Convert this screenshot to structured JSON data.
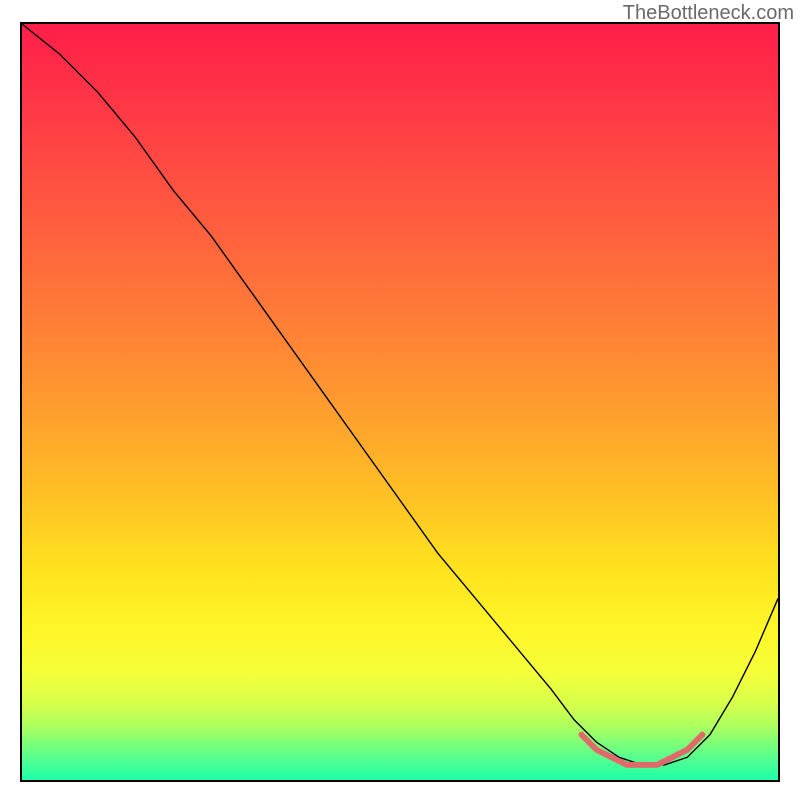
{
  "watermark": "TheBottleneck.com",
  "chart_data": {
    "type": "line",
    "title": "",
    "xlabel": "",
    "ylabel": "",
    "xlim": [
      0,
      100
    ],
    "ylim": [
      0,
      100
    ],
    "series": [
      {
        "name": "bottleneck-curve",
        "stroke": "#000000",
        "stroke_width": 1.4,
        "x": [
          0,
          5,
          10,
          15,
          20,
          25,
          30,
          35,
          40,
          45,
          50,
          55,
          60,
          65,
          70,
          73,
          76,
          79,
          82,
          85,
          88,
          91,
          94,
          97,
          100
        ],
        "y": [
          100,
          96,
          91,
          85,
          78,
          72,
          65,
          58,
          51,
          44,
          37,
          30,
          24,
          18,
          12,
          8,
          5,
          3,
          2,
          2,
          3,
          6,
          11,
          17,
          24
        ]
      },
      {
        "name": "optimal-marker-band",
        "stroke": "#e06a6a",
        "stroke_width": 6,
        "x": [
          74,
          76,
          78,
          80,
          82,
          84,
          86,
          88,
          90
        ],
        "y": [
          6,
          4,
          3,
          2,
          2,
          2,
          3,
          4,
          6
        ]
      }
    ],
    "gradient": {
      "direction": "vertical-top-to-bottom",
      "stops": [
        {
          "offset": 0.0,
          "color": "#ff1e49"
        },
        {
          "offset": 0.12,
          "color": "#ff3a46"
        },
        {
          "offset": 0.25,
          "color": "#ff5a3f"
        },
        {
          "offset": 0.38,
          "color": "#ff7a38"
        },
        {
          "offset": 0.5,
          "color": "#ff9b2f"
        },
        {
          "offset": 0.62,
          "color": "#ffbf25"
        },
        {
          "offset": 0.72,
          "color": "#ffe21e"
        },
        {
          "offset": 0.8,
          "color": "#fff628"
        },
        {
          "offset": 0.86,
          "color": "#f4ff3a"
        },
        {
          "offset": 0.9,
          "color": "#d6ff4b"
        },
        {
          "offset": 0.93,
          "color": "#abff5f"
        },
        {
          "offset": 0.96,
          "color": "#6cff83"
        },
        {
          "offset": 1.0,
          "color": "#1dffab"
        }
      ]
    }
  }
}
